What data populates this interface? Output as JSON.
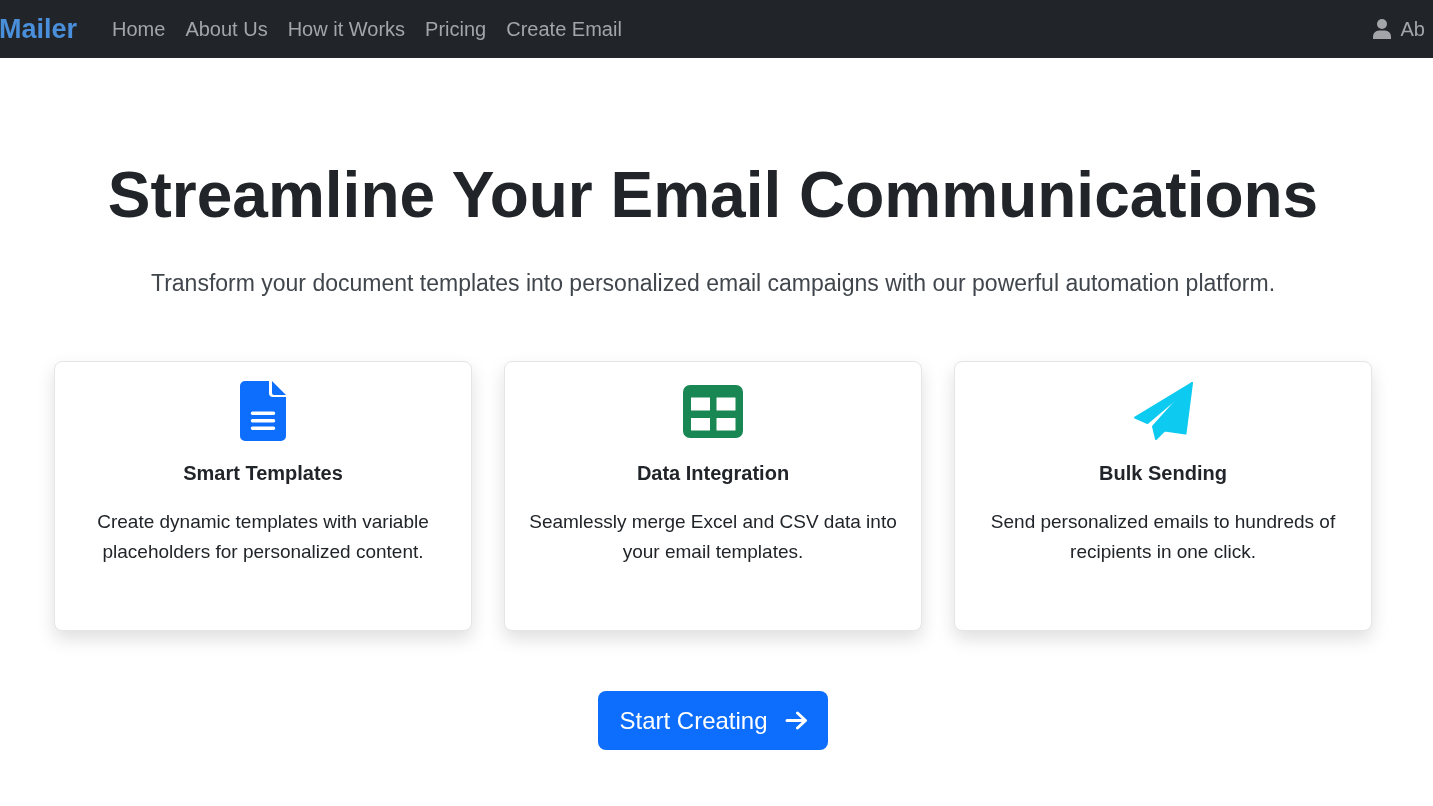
{
  "navbar": {
    "brand": "Mailer",
    "links": [
      "Home",
      "About Us",
      "How it Works",
      "Pricing",
      "Create Email"
    ],
    "user": "Ab"
  },
  "hero": {
    "title": "Streamline Your Email Communications",
    "subtitle": "Transform your document templates into personalized email campaigns with our powerful automation platform."
  },
  "features": [
    {
      "title": "Smart Templates",
      "description": "Create dynamic templates with variable placeholders for personalized content.",
      "color": "#0d6efd"
    },
    {
      "title": "Data Integration",
      "description": "Seamlessly merge Excel and CSV data into your email templates.",
      "color": "#198754"
    },
    {
      "title": "Bulk Sending",
      "description": "Send personalized emails to hundreds of recipients in one click.",
      "color": "#0dcaf0"
    }
  ],
  "cta": {
    "label": "Start Creating"
  }
}
